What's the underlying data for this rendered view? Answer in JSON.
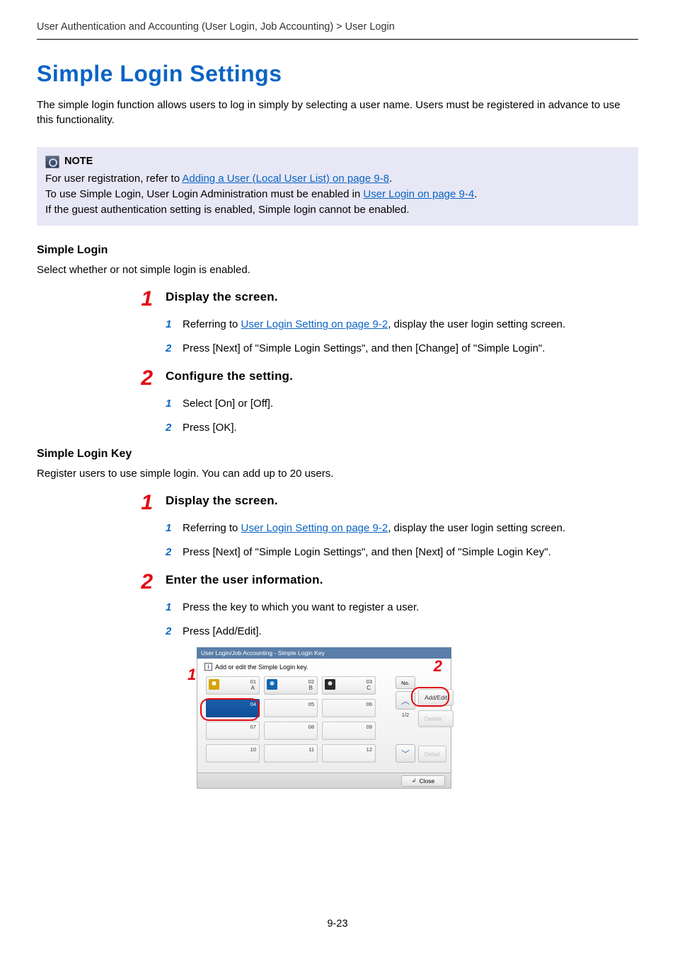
{
  "breadcrumb": "User Authentication and Accounting (User Login, Job Accounting) > User Login",
  "title": "Simple Login Settings",
  "intro": "The simple login function allows users to log in simply by selecting a user name. Users must be registered in advance to use this functionality.",
  "note": {
    "label": "NOTE",
    "line1_prefix": "For user registration, refer to ",
    "line1_link": "Adding a User (Local User List) on page 9-8",
    "line1_suffix": ".",
    "line2_prefix": "To use Simple Login, User Login Administration must be enabled in ",
    "line2_link": "User Login on page 9-4",
    "line2_suffix": ".",
    "line3": "If the guest authentication setting is enabled, Simple login cannot be enabled."
  },
  "simple_login": {
    "heading": "Simple Login",
    "desc": "Select whether or not simple login is enabled."
  },
  "sl_step1": {
    "num": "1",
    "title": "Display the screen.",
    "s1": {
      "num": "1",
      "prefix": "Referring to ",
      "link": "User Login Setting on page 9-2",
      "suffix": ", display the user login setting screen."
    },
    "s2": {
      "num": "2",
      "text": "Press [Next] of \"Simple Login Settings\", and then [Change] of \"Simple Login\"."
    }
  },
  "sl_step2": {
    "num": "2",
    "title": "Configure the setting.",
    "s1": {
      "num": "1",
      "text": "Select [On] or [Off]."
    },
    "s2": {
      "num": "2",
      "text": "Press [OK]."
    }
  },
  "simple_login_key": {
    "heading": "Simple Login Key",
    "desc": "Register users to use simple login. You can add up to 20 users."
  },
  "slk_step1": {
    "num": "1",
    "title": "Display the screen.",
    "s1": {
      "num": "1",
      "prefix": "Referring to ",
      "link": "User Login Setting on page 9-2",
      "suffix": ", display the user login setting screen."
    },
    "s2": {
      "num": "2",
      "text": "Press [Next] of \"Simple Login Settings\", and then [Next] of \"Simple Login Key\"."
    }
  },
  "slk_step2": {
    "num": "2",
    "title": "Enter the user information.",
    "s1": {
      "num": "1",
      "text": "Press the key to which you want to register a user."
    },
    "s2": {
      "num": "2",
      "text": "Press [Add/Edit]."
    }
  },
  "panel": {
    "callout": {
      "one": "1",
      "two": "2"
    },
    "head": "User Login/Job Accounting - Simple Login Key",
    "hint": "Add or edit the Simple Login key.",
    "keys": {
      "k01": {
        "num": "01",
        "name": "A"
      },
      "k02": {
        "num": "02",
        "name": "B"
      },
      "k03": {
        "num": "03",
        "name": "C"
      },
      "k04": {
        "num": "04"
      },
      "k05": {
        "num": "05"
      },
      "k06": {
        "num": "06"
      },
      "k07": {
        "num": "07"
      },
      "k08": {
        "num": "08"
      },
      "k09": {
        "num": "09"
      },
      "k10": {
        "num": "10"
      },
      "k11": {
        "num": "11"
      },
      "k12": {
        "num": "12"
      }
    },
    "side": {
      "no_label": "No.",
      "up_glyph": "︿",
      "down_glyph": "﹀",
      "page_ind": "1/2",
      "add_edit": "Add/Edit",
      "delete": "Delete",
      "detail": "Detail"
    },
    "close": "Close"
  },
  "page_number": "9-23"
}
